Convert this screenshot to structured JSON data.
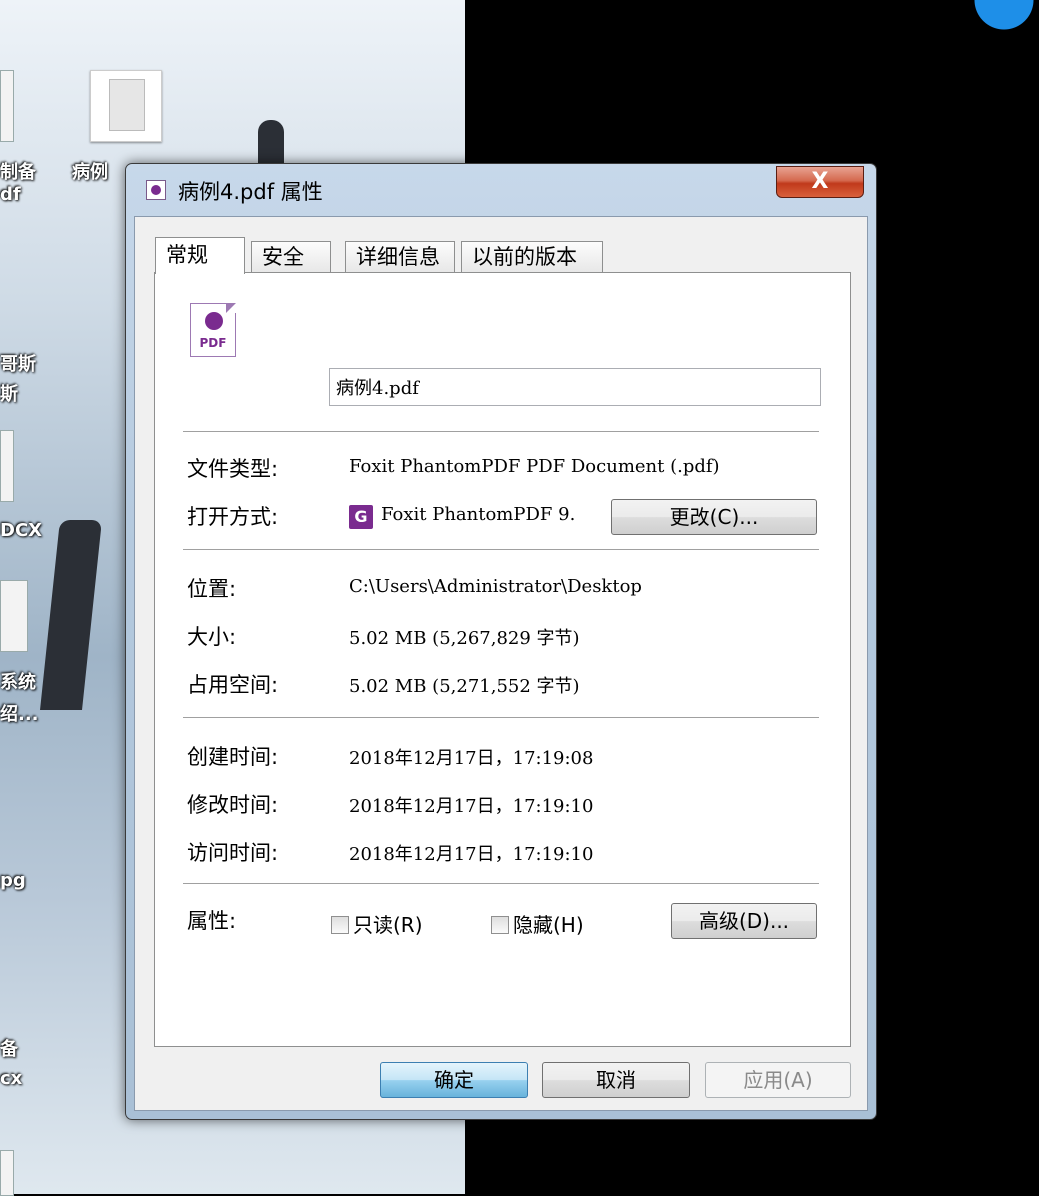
{
  "desktop": {
    "icons": [
      {
        "label": "制备",
        "sub": "df"
      },
      {
        "label": "病例",
        "sub": ""
      },
      {
        "label": "哥斯",
        "sub": "斯"
      },
      {
        "label": "DCX",
        "sub": ""
      },
      {
        "label": "系统",
        "sub": "绍..."
      },
      {
        "label": "pg",
        "sub": ""
      },
      {
        "label": "备",
        "sub": "cx"
      }
    ]
  },
  "dialog": {
    "title": "病例4.pdf 属性",
    "close_label": "X",
    "tabs": [
      {
        "label": "常规",
        "active": true
      },
      {
        "label": "安全",
        "active": false
      },
      {
        "label": "详细信息",
        "active": false
      },
      {
        "label": "以前的版本",
        "active": false
      }
    ],
    "file_icon_label": "PDF",
    "file_name": "病例4.pdf",
    "type_label": "文件类型:",
    "type_value": "Foxit PhantomPDF PDF Document (.pdf)",
    "opens_label": "打开方式:",
    "opens_value": "Foxit PhantomPDF 9.",
    "opens_icon": "G",
    "change_button": "更改(C)...",
    "location_label": "位置:",
    "location_value": "C:\\Users\\Administrator\\Desktop",
    "size_label": "大小:",
    "size_value": "5.02 MB (5,267,829 字节)",
    "disk_label": "占用空间:",
    "disk_value": "5.02 MB (5,271,552 字节)",
    "created_label": "创建时间:",
    "created_value": "2018年12月17日，17:19:08",
    "modified_label": "修改时间:",
    "modified_value": "2018年12月17日，17:19:10",
    "accessed_label": "访问时间:",
    "accessed_value": "2018年12月17日，17:19:10",
    "attributes_label": "属性:",
    "readonly_label": "只读(R)",
    "readonly_checked": false,
    "hidden_label": "隐藏(H)",
    "hidden_checked": false,
    "advanced_button": "高级(D)...",
    "ok_button": "确定",
    "cancel_button": "取消",
    "apply_button": "应用(A)"
  }
}
